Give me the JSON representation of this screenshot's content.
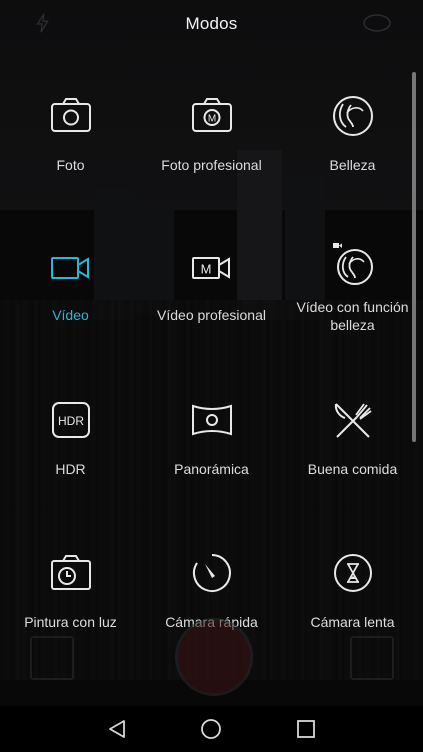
{
  "header": {
    "title": "Modos"
  },
  "modes": [
    {
      "label": "Foto",
      "icon": "camera-icon",
      "active": false
    },
    {
      "label": "Foto profesional",
      "icon": "pro-camera-icon",
      "active": false
    },
    {
      "label": "Belleza",
      "icon": "beauty-face-icon",
      "active": false
    },
    {
      "label": "Vídeo",
      "icon": "video-camera-icon",
      "active": true
    },
    {
      "label": "Vídeo profesional",
      "icon": "pro-video-icon",
      "active": false
    },
    {
      "label": "Vídeo con función belleza",
      "icon": "beauty-video-icon",
      "active": false
    },
    {
      "label": "HDR",
      "icon": "hdr-icon",
      "active": false,
      "icon_text": "HDR"
    },
    {
      "label": "Panorámica",
      "icon": "panorama-icon",
      "active": false
    },
    {
      "label": "Buena comida",
      "icon": "fork-knife-icon",
      "active": false
    },
    {
      "label": "Pintura con luz",
      "icon": "light-painting-icon",
      "active": false
    },
    {
      "label": "Cámara rápida",
      "icon": "time-lapse-icon",
      "active": false
    },
    {
      "label": "Cámara lenta",
      "icon": "slow-motion-icon",
      "active": false
    }
  ],
  "icon_letters": {
    "pro": "M"
  },
  "colors": {
    "active": "#2bb5d6",
    "text": "#dcdcdc",
    "background": "#0d0d0e"
  },
  "navbar": {
    "back": "back-icon",
    "home": "home-icon",
    "recents": "recents-icon"
  }
}
